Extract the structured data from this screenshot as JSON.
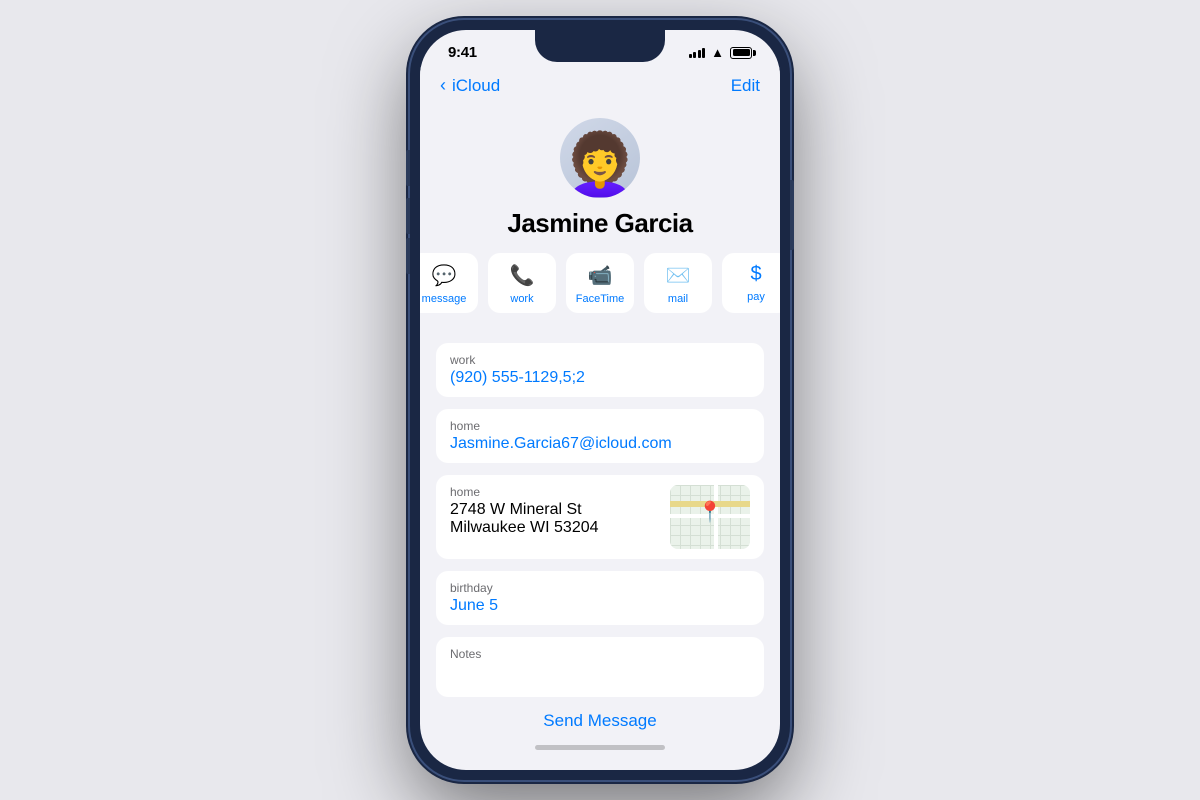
{
  "status_bar": {
    "time": "9:41",
    "signal_bars": [
      4,
      6,
      8,
      10,
      12
    ],
    "wifi": "WiFi",
    "battery_full": true
  },
  "nav": {
    "back_label": "iCloud",
    "edit_label": "Edit"
  },
  "profile": {
    "name": "Jasmine Garcia",
    "avatar_emoji": "🧑‍🦱"
  },
  "actions": [
    {
      "id": "message",
      "icon": "💬",
      "label": "message"
    },
    {
      "id": "work",
      "icon": "📞",
      "label": "work"
    },
    {
      "id": "facetime",
      "icon": "📹",
      "label": "FaceTime"
    },
    {
      "id": "mail",
      "icon": "✉️",
      "label": "mail"
    },
    {
      "id": "pay",
      "icon": "💲",
      "label": "pay"
    }
  ],
  "info_rows": [
    {
      "label": "work",
      "value": "(920) 555-1129,5;2",
      "type": "phone",
      "has_map": false
    },
    {
      "label": "home",
      "value": "Jasmine.Garcia67@icloud.com",
      "type": "email",
      "has_map": false
    },
    {
      "label": "home",
      "value_line1": "2748 W Mineral St",
      "value_line2": "Milwaukee WI 53204",
      "type": "address",
      "has_map": true
    },
    {
      "label": "birthday",
      "value": "June 5",
      "type": "date",
      "has_map": false
    }
  ],
  "notes": {
    "label": "Notes",
    "value": ""
  },
  "footer": {
    "send_message": "Send Message"
  }
}
